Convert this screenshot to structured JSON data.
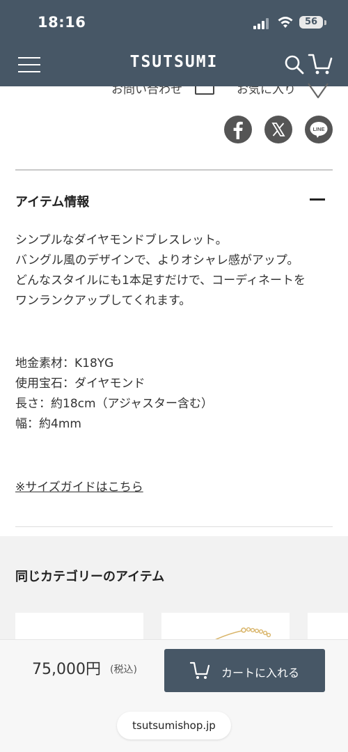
{
  "status_bar": {
    "time": "18:16",
    "battery": "56"
  },
  "header": {
    "brand": "TSUTSUMI",
    "menu_icon": "hamburger-menu-icon",
    "search_icon": "search-icon",
    "cart_icon": "cart-icon",
    "background_color": "#475766"
  },
  "product_actions": {
    "inquiry_label": "お問い合わせ",
    "favorite_label": "お気に入り"
  },
  "share": {
    "facebook_icon": "facebook-icon",
    "x_icon": "x-icon",
    "line_icon": "line-icon",
    "line_text": "LINE"
  },
  "item_info": {
    "title": "アイテム情報",
    "description": [
      "シンプルなダイヤモンドブレスレット。",
      "バングル風のデザインで、よりオシャレ感がアップ。",
      "どんなスタイルにも1本足すだけで、コーディネートを",
      "ワンランクアップしてくれます。"
    ],
    "specs": [
      "地金素材：K18YG",
      "使用宝石：ダイヤモンド",
      "長さ：約18cm（アジャスター含む）",
      "幅：約4mm"
    ],
    "size_guide_link": "※サイズガイドはこちら"
  },
  "related": {
    "title": "同じカテゴリーのアイテム"
  },
  "purchase_bar": {
    "price": "75,000円",
    "tax_note": "(税込)",
    "add_to_cart_label": "カートに入れる"
  },
  "browser": {
    "url": "tsutsumishop.jp"
  }
}
